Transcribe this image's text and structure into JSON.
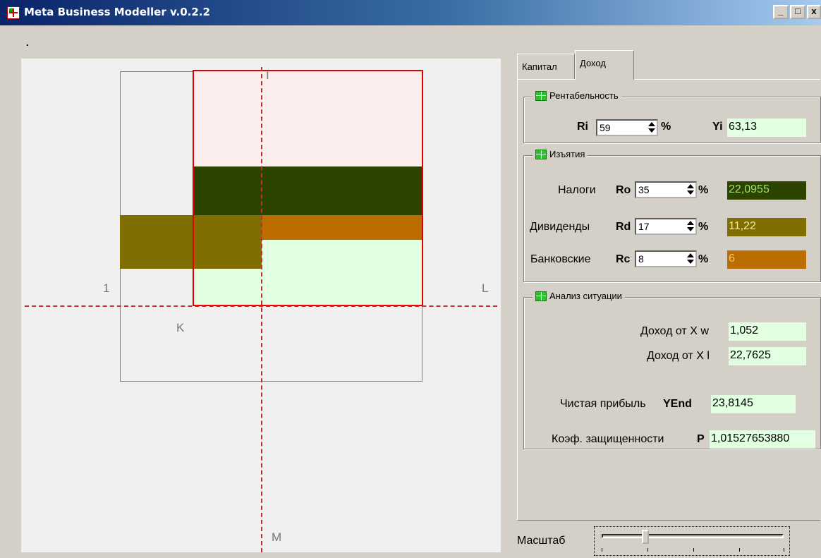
{
  "window": {
    "title": "Meta Business Modeller v.0.2.2",
    "buttons": {
      "minimize": "_",
      "maximize": "□",
      "close": "x"
    }
  },
  "canvas": {
    "labels": {
      "top": "I",
      "left": "1",
      "right": "L",
      "k": "K",
      "bottom": "M"
    },
    "colors": {
      "red_frame": "#e00000",
      "pink": "#fdeeee",
      "dark_green": "#2c4400",
      "olive": "#806e00",
      "orange": "#bb6d00",
      "light_green": "#e2ffe2",
      "gray_line": "#808080"
    }
  },
  "tabs": [
    {
      "label": "Капитал",
      "active": false
    },
    {
      "label": "Доход",
      "active": true
    }
  ],
  "profitability": {
    "legend": "Рентабельность",
    "ri_label": "Ri",
    "ri_value": "59",
    "pct": "%",
    "yi_label": "Yi",
    "yi_value": "63,13"
  },
  "withdrawals": {
    "legend": "Изъятия",
    "rows": [
      {
        "label": "Налоги",
        "code": "Ro",
        "value": "35",
        "pct": "%",
        "result": "22,0955",
        "color": "#2c4400",
        "text_color": "#9fdf6f"
      },
      {
        "label": "Дивиденды",
        "code": "Rd",
        "value": "17",
        "pct": "%",
        "result": "11,22",
        "color": "#806e00",
        "text_color": "#f3ea9a"
      },
      {
        "label": "Банковские",
        "code": "Rc",
        "value": "8",
        "pct": "%",
        "result": "6",
        "color": "#bb6d00",
        "text_color": "#f7c36a"
      }
    ]
  },
  "analysis": {
    "legend": "Анализ ситуации",
    "income_xw_label": "Доход от X w",
    "income_xw_value": "1,052",
    "income_xl_label": "Доход от X l",
    "income_xl_value": "22,7625",
    "net_profit_label": "Чистая прибыль",
    "net_profit_code": "YEnd",
    "net_profit_value": "23,8145",
    "security_label": "Коэф. защищенности",
    "security_code": "P",
    "security_value": "1,01527653880"
  },
  "scale": {
    "label": "Масштаб",
    "position": 0.25
  }
}
